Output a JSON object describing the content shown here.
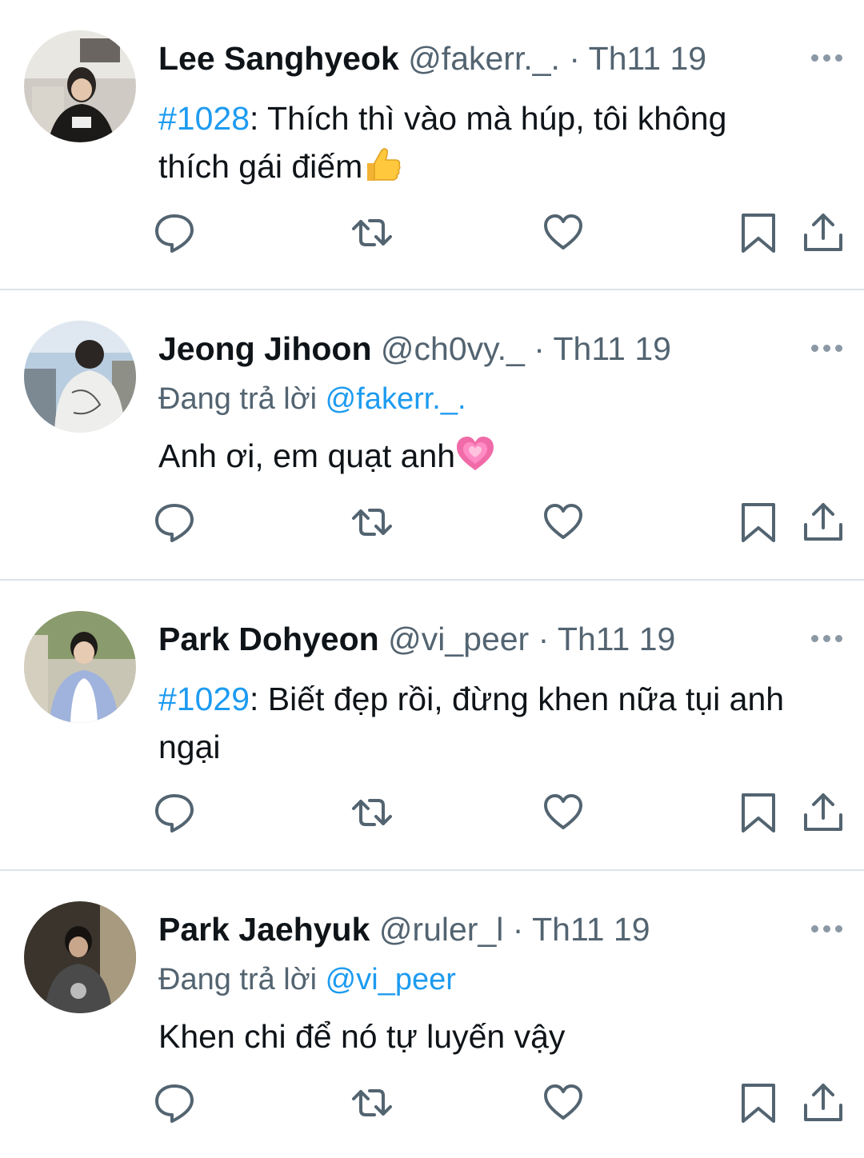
{
  "tweets": [
    {
      "name": "Lee Sanghyeok",
      "handle": "@fakerr._.",
      "sep": "·",
      "date": "Th11 19",
      "reply_prefix": "",
      "reply_to": "",
      "tag": "#1028",
      "text": ": Thích thì vào mà húp, tôi không thích gái điếm",
      "emoji": "thumbs-up-icon"
    },
    {
      "name": "Jeong Jihoon",
      "handle": "@ch0vy._",
      "sep": "·",
      "date": "Th11 19",
      "reply_prefix": "Đang trả lời ",
      "reply_to": "@fakerr._.",
      "tag": "",
      "text": "Anh ơi, em quạt anh",
      "emoji": "growing-heart-icon"
    },
    {
      "name": "Park Dohyeon",
      "handle": "@vi_peer",
      "sep": "·",
      "date": "Th11 19",
      "reply_prefix": "",
      "reply_to": "",
      "tag": "#1029",
      "text": ": Biết đẹp rồi, đừng khen nữa tụi anh ngại",
      "emoji": ""
    },
    {
      "name": "Park Jaehyuk",
      "handle": "@ruler_l",
      "sep": "·",
      "date": "Th11 19",
      "reply_prefix": "Đang trả lời ",
      "reply_to": "@vi_peer",
      "tag": "",
      "text": "Khen chi để nó tự luyến vậy",
      "emoji": ""
    }
  ],
  "icons": [
    "reply-icon",
    "retweet-icon",
    "like-icon",
    "bookmark-icon",
    "share-icon",
    "more-icon"
  ],
  "colors": {
    "link": "#1d9bf0",
    "secondary": "#536471",
    "text": "#0f1419",
    "icon": "#536471"
  }
}
